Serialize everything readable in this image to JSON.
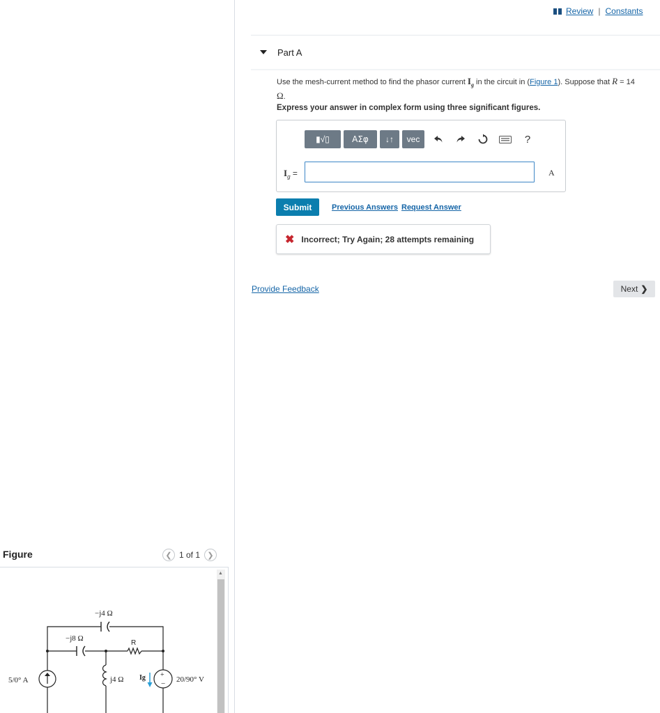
{
  "top_links": {
    "review": "Review",
    "separator": "|",
    "constants": "Constants"
  },
  "part": {
    "title": "Part A"
  },
  "question": {
    "before": "Use the mesh-current method to find the phasor current",
    "symbol": "I",
    "subscript": "g",
    "middle": "in the circuit in",
    "link_open": "(",
    "link": "Figure 1",
    "link_close": ").",
    "suffix": "Suppose that",
    "var": "R",
    "value": "= 14",
    "unit": "Ω",
    "unit_end": "."
  },
  "instruction": "Express your answer in complex form using three significant figures.",
  "toolbar": {
    "template_label": "▮√▯",
    "greek_label": "ΑΣφ",
    "arrows_label": "↓↑",
    "vec_label": "vec",
    "icons": [
      "undo-icon",
      "redo-icon",
      "reset-icon",
      "keyboard-icon",
      "help-icon"
    ],
    "help_label": "?"
  },
  "answer": {
    "label_symbol": "I",
    "label_sub": "g",
    "label_eq": "=",
    "value": "",
    "unit": "A"
  },
  "actions": {
    "submit": "Submit",
    "previous": "Previous Answers",
    "request": "Request Answer"
  },
  "feedback": {
    "text": "Incorrect; Try Again; 28 attempts remaining",
    "color": "#c6262e"
  },
  "footer": {
    "provide_feedback": "Provide Feedback",
    "next": "Next"
  },
  "figure": {
    "title": "Figure",
    "pager": "1 of 1",
    "labels": {
      "cap_top": "−j4 Ω",
      "cap_left": "−j8 Ω",
      "resistor": "R",
      "current_source": "5/0° A",
      "inductor": "j4 Ω",
      "current": "Ig",
      "voltage_source": "20/90° V"
    }
  },
  "colors": {
    "link": "#1565a7",
    "submit": "#0b7eae",
    "toolbar": "#6d7a86",
    "current_arrow": "#2a9fd6"
  }
}
